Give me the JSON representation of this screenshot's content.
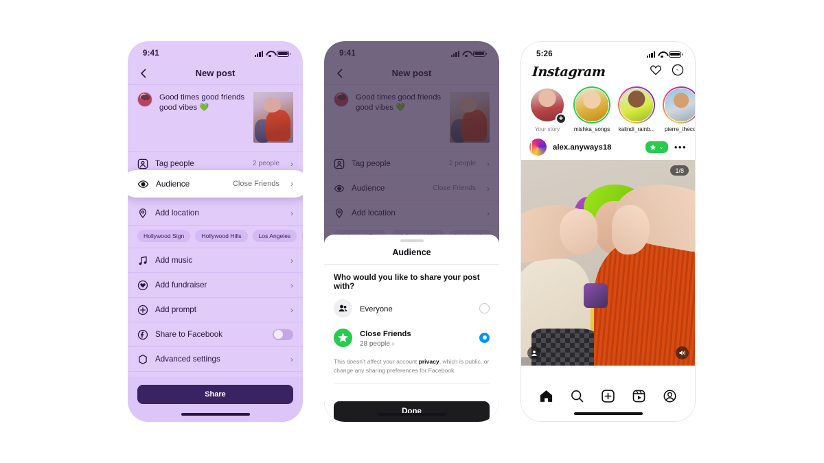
{
  "phone1": {
    "status": {
      "time": "9:41"
    },
    "nav": {
      "title": "New post",
      "back_icon": "chevron-left-icon"
    },
    "caption": {
      "text": "Good times good friends good vibes ",
      "emoji": "💚"
    },
    "rows": [
      {
        "icon": "tag-people-icon",
        "label": "Tag people",
        "value": "2 people",
        "chevron": "›"
      },
      {
        "icon": "location-icon",
        "label": "Add location",
        "value": "",
        "chevron": "›"
      },
      {
        "icon": "music-icon",
        "label": "Add music",
        "value": "",
        "chevron": "›"
      },
      {
        "icon": "fundraiser-icon",
        "label": "Add fundraiser",
        "value": "",
        "chevron": "›"
      },
      {
        "icon": "plus-circle-icon",
        "label": "Add prompt",
        "value": "",
        "chevron": "›"
      },
      {
        "icon": "facebook-icon",
        "label": "Share to Facebook",
        "value": "",
        "chevron": ""
      },
      {
        "icon": "advanced-settings-icon",
        "label": "Advanced settings",
        "value": "",
        "chevron": "›"
      }
    ],
    "audience_row": {
      "icon": "close-friends-eye-icon",
      "label": "Audience",
      "value": "Close Friends",
      "chevron": "›"
    },
    "location_tags": [
      "Hollywood Sign",
      "Hollywood Hills",
      "Los Angeles",
      "P"
    ],
    "share_button": "Share"
  },
  "phone2": {
    "status": {
      "time": "9:41"
    },
    "nav": {
      "title": "New post",
      "back_icon": "chevron-left-icon"
    },
    "caption": {
      "text": "Good times good friends good vibes ",
      "emoji": "💚"
    },
    "rows": [
      {
        "icon": "tag-people-icon",
        "label": "Tag people",
        "value": "2 people",
        "chevron": "›"
      },
      {
        "icon": "close-friends-eye-icon",
        "label": "Audience",
        "value": "Close Friends",
        "chevron": "›"
      },
      {
        "icon": "location-icon",
        "label": "Add location",
        "value": "",
        "chevron": "›"
      }
    ],
    "location_tags": [
      "Hollywood Sign",
      "Hollywood Hills",
      "Los Angeles",
      "R"
    ],
    "sheet": {
      "title": "Audience",
      "question": "Who would you like to share your post with?",
      "options": [
        {
          "icon": "people-icon",
          "name": "Everyone",
          "sub": "",
          "selected": false
        },
        {
          "icon": "star-icon",
          "name": "Close Friends",
          "sub": "28 people ›",
          "selected": true
        }
      ],
      "note_prefix": "This doesn’t affect your account ",
      "note_link": "privacy",
      "note_suffix": ", which is public, or change any sharing preferences for Facebook.",
      "done_button": "Done"
    }
  },
  "phone3": {
    "status": {
      "time": "5:26"
    },
    "header": {
      "logo": "Instagram",
      "icons": [
        "heart-icon",
        "messenger-icon"
      ]
    },
    "stories": [
      {
        "name": "Your story",
        "ring": "none",
        "has_plus": true
      },
      {
        "name": "mishka_songs",
        "ring": "green",
        "has_plus": false
      },
      {
        "name": "kalindi_rainb...",
        "ring": "gradient",
        "has_plus": false
      },
      {
        "name": "pierre_thecor",
        "ring": "gradient",
        "has_plus": false
      }
    ],
    "post": {
      "username": "alex.anyways18",
      "close_friends_badge": "star-icon",
      "badge_chevron": "⌄",
      "more_icon": "more-options-icon",
      "carousel_counter": "1/8",
      "tagged_people_icon": "person-icon",
      "audio_icon": "speaker-icon"
    },
    "tabbar": [
      "home-icon",
      "search-icon",
      "create-icon",
      "reels-icon",
      "profile-icon"
    ]
  },
  "colors": {
    "lavender_bg": "#E0CBF9",
    "deep_purple": "#3A2363",
    "close_friends_green": "#27CB4E",
    "instagram_blue": "#0095F6",
    "dark_button": "#1C1C1E"
  }
}
